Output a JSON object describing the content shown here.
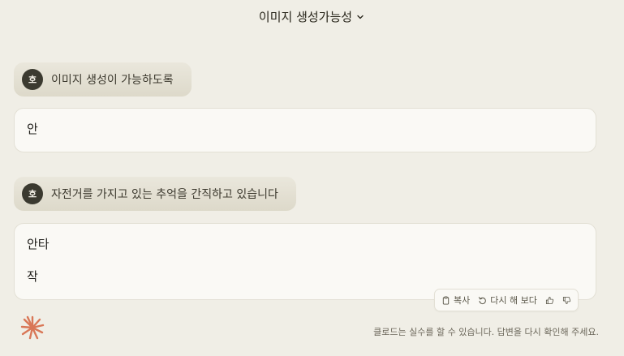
{
  "header": {
    "title": "이미지 생성가능성",
    "chevron_icon": "chevron-down-icon"
  },
  "messages": [
    {
      "user": {
        "avatar_initial": "호",
        "text": "이미지 생성이 가능하도록"
      },
      "reply": {
        "lines": [
          "안"
        ]
      }
    },
    {
      "user": {
        "avatar_initial": "호",
        "text": "자전거를 가지고 있는 추억을 간직하고 있습니다"
      },
      "reply": {
        "lines": [
          "안타",
          "작"
        ]
      }
    }
  ],
  "actions": {
    "copy_label": "복사",
    "retry_label": "다시 해 보다",
    "icons": [
      "clipboard-icon",
      "retry-icon",
      "thumbs-up-icon",
      "thumbs-down-icon"
    ]
  },
  "footer": {
    "disclaimer": "클로드는 실수를 할 수 있습니다. 답변을 다시 확인해 주세요.",
    "logo_icon": "claude-logo-icon"
  },
  "colors": {
    "background": "#f0eee6",
    "card": "#faf9f5",
    "avatar": "#3b3a30",
    "logo": "#d97757"
  }
}
